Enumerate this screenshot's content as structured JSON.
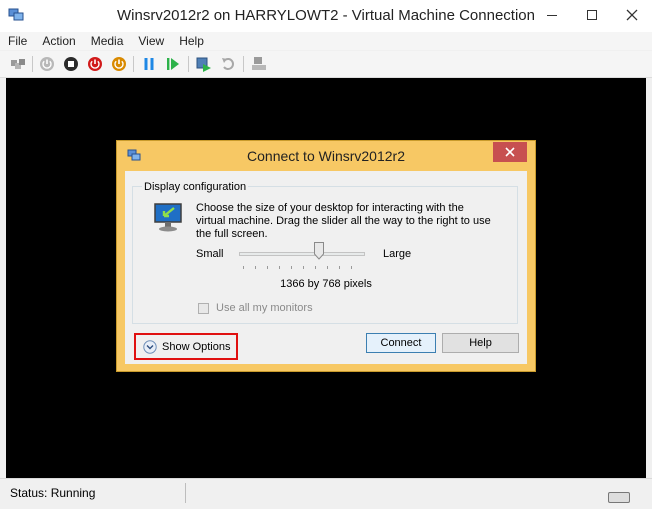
{
  "window": {
    "title": "Winsrv2012r2 on HARRYLOWT2 - Virtual Machine Connection",
    "icon": "vm-connection-icon"
  },
  "menu": {
    "items": [
      "File",
      "Action",
      "Media",
      "View",
      "Help"
    ]
  },
  "toolbar": {
    "buttons": [
      "ctrl-alt-del-icon",
      "start-icon",
      "turn-off-icon",
      "shutdown-icon",
      "save-icon",
      "pause-icon",
      "resume-icon",
      "checkpoint-icon",
      "revert-icon",
      "enhanced-session-icon"
    ],
    "colors": {
      "stop": "#2b2b2b",
      "shutdown": "#d11a1a",
      "save": "#d98a00",
      "pause": "#1e88e5",
      "resume": "#2db24a"
    }
  },
  "dialog": {
    "title": "Connect to Winsrv2012r2",
    "group_label": "Display configuration",
    "description": "Choose the size of your desktop for interacting with the virtual machine. Drag the slider all the way to the right to use the full screen.",
    "slider_min_label": "Small",
    "slider_max_label": "Large",
    "slider_level": 0.65,
    "resolution": "1366 by 768 pixels",
    "use_all_monitors_label": "Use all my monitors",
    "use_all_monitors_checked": false,
    "show_options_label": "Show Options",
    "connect_label": "Connect",
    "help_label": "Help",
    "frame_color": "#f7c864",
    "highlight_color": "#e01010"
  },
  "status": {
    "text": "Status: Running"
  }
}
